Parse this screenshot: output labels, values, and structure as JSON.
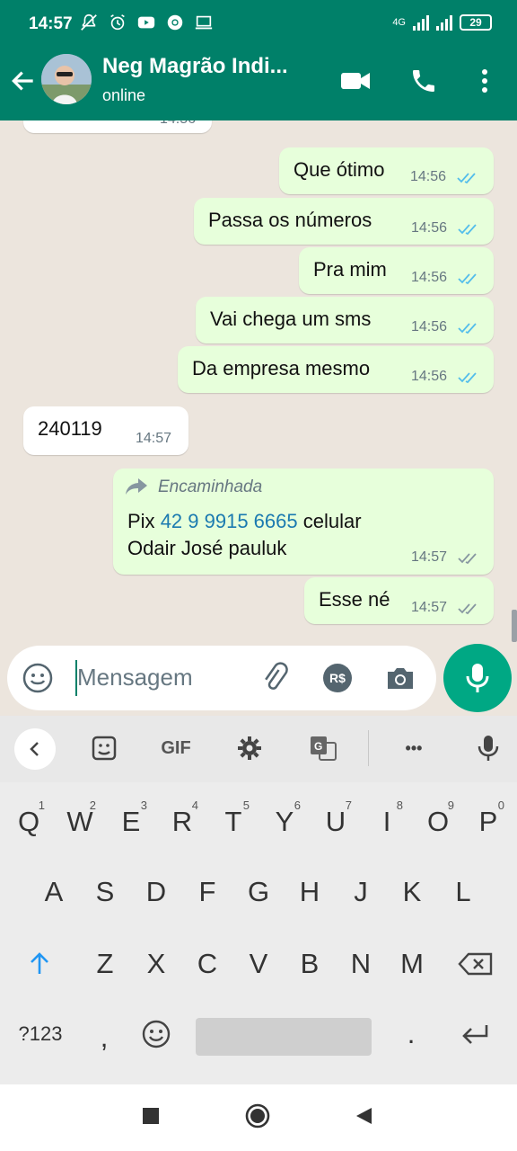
{
  "status_bar": {
    "time": "14:57",
    "network": "4G",
    "battery": "29"
  },
  "header": {
    "contact_name": "Neg Magrão Indi...",
    "status": "online"
  },
  "messages": [
    {
      "dir": "out",
      "text": "Que ótimo",
      "time": "14:56",
      "read": true
    },
    {
      "dir": "out",
      "text": "Passa os números",
      "time": "14:56",
      "read": true
    },
    {
      "dir": "out",
      "text": "Pra mim",
      "time": "14:56",
      "read": true
    },
    {
      "dir": "out",
      "text": "Vai chega um sms",
      "time": "14:56",
      "read": true
    },
    {
      "dir": "out",
      "text": "Da empresa mesmo",
      "time": "14:56",
      "read": true
    },
    {
      "dir": "in",
      "text": "240119",
      "time": "14:57"
    },
    {
      "dir": "out",
      "forwarded_label": "Encaminhada",
      "text_prefix": "Pix",
      "phone": "42 9 9915 6665",
      "text_suffix": "celular",
      "text_line2": "Odair José pauluk",
      "time": "14:57",
      "read": false
    },
    {
      "dir": "out",
      "text": "Esse né",
      "time": "14:57",
      "read": false
    }
  ],
  "partial_top_time": "14:56",
  "input": {
    "placeholder": "Mensagem",
    "currency_label": "R$"
  },
  "keyboard": {
    "toolbar": {
      "gif_label": "GIF",
      "more_label": "•••"
    },
    "row1": [
      "Q",
      "W",
      "E",
      "R",
      "T",
      "Y",
      "U",
      "I",
      "O",
      "P"
    ],
    "row1_digits": [
      "1",
      "2",
      "3",
      "4",
      "5",
      "6",
      "7",
      "8",
      "9",
      "0"
    ],
    "row2": [
      "A",
      "S",
      "D",
      "F",
      "G",
      "H",
      "J",
      "K",
      "L"
    ],
    "row3": [
      "Z",
      "X",
      "C",
      "V",
      "B",
      "N",
      "M"
    ],
    "symbols_label": "?123",
    "comma": ",",
    "period": "."
  },
  "colors": {
    "header": "#008069",
    "outgoing": "#e7ffdb",
    "incoming": "#ffffff",
    "read_ticks": "#53bdeb",
    "mic": "#00a884"
  }
}
